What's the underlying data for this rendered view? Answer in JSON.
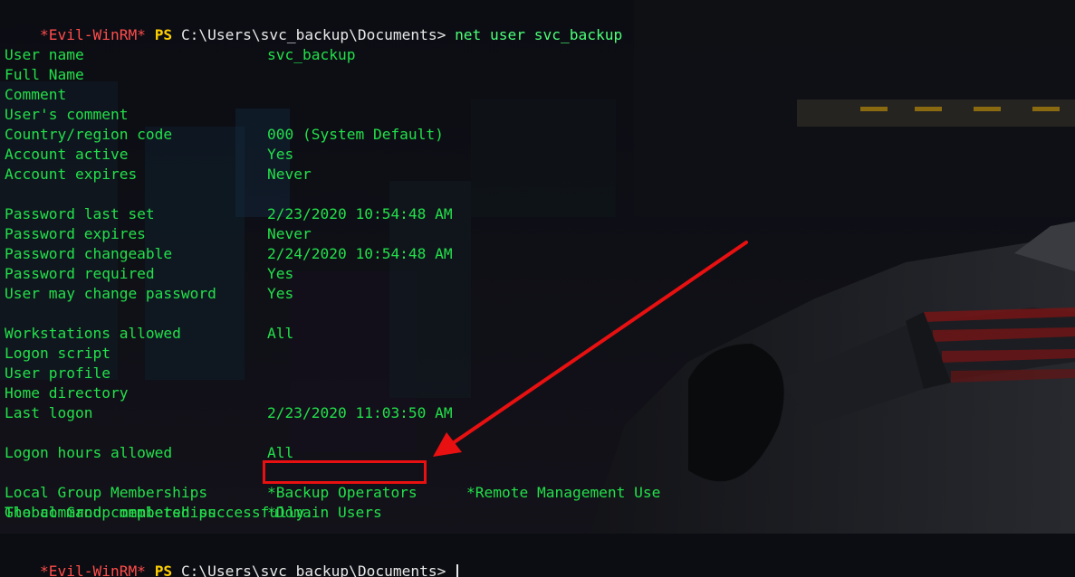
{
  "prompt": {
    "tag": "*Evil-WinRM*",
    "ps": "PS",
    "path": "C:\\Users\\svc_backup\\Documents>",
    "command": "net user svc_backup"
  },
  "output": {
    "user_name": {
      "key": "User name",
      "value": "svc_backup"
    },
    "full_name": {
      "key": "Full Name",
      "value": ""
    },
    "comment": {
      "key": "Comment",
      "value": ""
    },
    "users_comment": {
      "key": "User's comment",
      "value": ""
    },
    "country_code": {
      "key": "Country/region code",
      "value": "000 (System Default)"
    },
    "account_active": {
      "key": "Account active",
      "value": "Yes"
    },
    "account_expires": {
      "key": "Account expires",
      "value": "Never"
    },
    "password_last_set": {
      "key": "Password last set",
      "value": "2/23/2020 10:54:48 AM"
    },
    "password_expires": {
      "key": "Password expires",
      "value": "Never"
    },
    "password_changeable": {
      "key": "Password changeable",
      "value": "2/24/2020 10:54:48 AM"
    },
    "password_required": {
      "key": "Password required",
      "value": "Yes"
    },
    "user_may_change_password": {
      "key": "User may change password",
      "value": "Yes"
    },
    "workstations_allowed": {
      "key": "Workstations allowed",
      "value": "All"
    },
    "logon_script": {
      "key": "Logon script",
      "value": ""
    },
    "user_profile": {
      "key": "User profile",
      "value": ""
    },
    "home_directory": {
      "key": "Home directory",
      "value": ""
    },
    "last_logon": {
      "key": "Last logon",
      "value": "2/23/2020 11:03:50 AM"
    },
    "logon_hours_allowed": {
      "key": "Logon hours allowed",
      "value": "All"
    },
    "local_groups": {
      "key": "Local Group Memberships",
      "value": "*Backup Operators",
      "value2": "*Remote Management Use"
    },
    "global_groups": {
      "key": "Global Group memberships",
      "value": "*Domain Users"
    },
    "completed": "The command completed successfully."
  },
  "prompt2": {
    "tag": "*Evil-WinRM*",
    "ps": "PS",
    "path": "C:\\Users\\svc_backup\\Documents>"
  },
  "colors": {
    "terminal_text": "#22e04a",
    "prompt_tag": "#ff4c4c",
    "prompt_ps": "#ffd000",
    "annotation": "#e81010",
    "background": "#0c0e14"
  }
}
